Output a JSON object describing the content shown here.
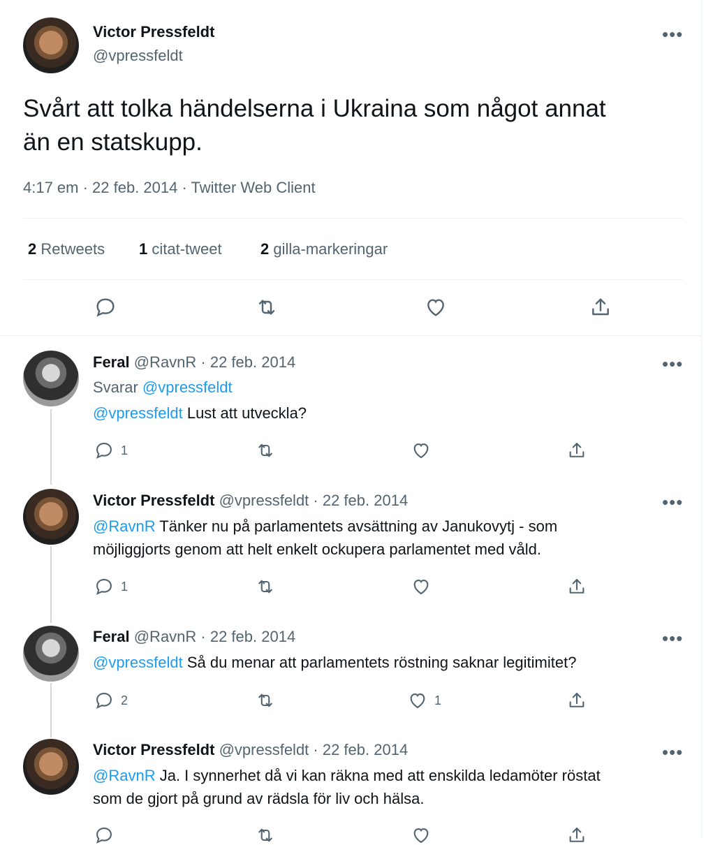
{
  "main_tweet": {
    "author_name": "Victor Pressfeldt",
    "author_handle": "@vpressfeldt",
    "text_line1": "Svårt att tolka händelserna i Ukraina som något annat",
    "text_line2": "än en statskupp.",
    "meta": "4:17 em · 22 feb. 2014 · Twitter Web Client",
    "retweets_count": "2",
    "retweets_label": "Retweets",
    "quotes_count": "1",
    "quotes_label": "citat-tweet",
    "likes_count": "2",
    "likes_label": "gilla-markeringar"
  },
  "replies": [
    {
      "name": "Feral",
      "handle_date": "@RavnR · 22 feb. 2014",
      "replying_prefix": "Svarar",
      "replying_to": "@vpressfeldt",
      "mention": "@vpressfeldt",
      "text": " Lust att utveckla?",
      "reply_count": "1",
      "like_count": ""
    },
    {
      "name": "Victor Pressfeldt",
      "handle_date": "@vpressfeldt · 22 feb. 2014",
      "mention": "@RavnR",
      "text_line1": " Tänker nu på parlamentets avsättning av Janukovytj - som",
      "text_line2": "möjliggjorts genom att helt enkelt ockupera parlamentet med våld.",
      "reply_count": "1",
      "like_count": ""
    },
    {
      "name": "Feral",
      "handle_date": "@RavnR · 22 feb. 2014",
      "mention": "@vpressfeldt",
      "text": " Så du menar att parlamentets röstning saknar legitimitet?",
      "reply_count": "2",
      "like_count": "1"
    },
    {
      "name": "Victor Pressfeldt",
      "handle_date": "@vpressfeldt · 22 feb. 2014",
      "mention": "@RavnR",
      "text_line1": " Ja. I synnerhet då vi kan räkna med att enskilda ledamöter röstat",
      "text_line2": "som de gjort på grund av rädsla för liv och hälsa.",
      "reply_count": "",
      "like_count": ""
    }
  ],
  "icons": {
    "reply": "reply-icon",
    "retweet": "retweet-icon",
    "like": "heart-icon",
    "share": "share-icon",
    "more": "more-icon"
  },
  "colors": {
    "link": "#1d9bf0",
    "secondary_text": "#536471",
    "divider": "#eff3f4"
  }
}
